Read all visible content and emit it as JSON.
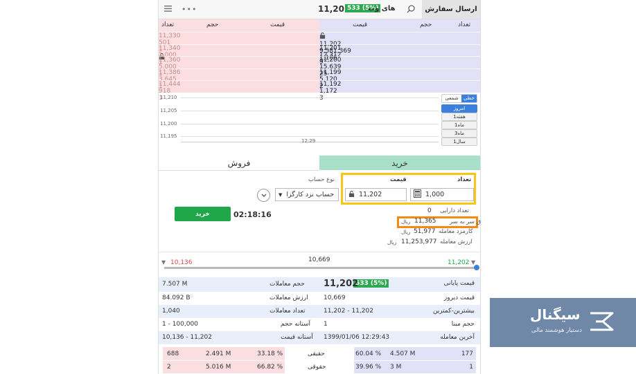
{
  "header": {
    "send_order": "ارسال سفارش",
    "stock_name": "های وب",
    "pct": "533 (5%)",
    "price": "11,202",
    "dots": "•••"
  },
  "orderbook": {
    "buy_headers": {
      "count": "تعداد",
      "volume": "حجم",
      "price": "قیمت"
    },
    "sell_headers": {
      "price": "قیمت",
      "volume": "حجم",
      "count": "تعداد"
    },
    "buy_rows": [
      {
        "count": "1,106",
        "volume": "9,581,369",
        "price": "11,202"
      },
      {
        "count": "9",
        "volume": "12,312",
        "price": "11,201"
      },
      {
        "count": "25",
        "volume": "15,639",
        "price": "11,200"
      },
      {
        "count": "2",
        "volume": "5,120",
        "price": "11,199"
      },
      {
        "count": "3",
        "volume": "1,172",
        "price": "11,192"
      }
    ],
    "sell_rows": [
      {
        "price": "11,330",
        "volume": "501",
        "count": "1"
      },
      {
        "price": "11,340",
        "volume": "1,000",
        "count": "1"
      },
      {
        "price": "11,360",
        "volume": "5,000",
        "count": "1"
      },
      {
        "price": "11,386",
        "volume": "3,645",
        "count": "1"
      },
      {
        "price": "11,444",
        "volume": "918",
        "count": "1"
      }
    ]
  },
  "chart": {
    "y_ticks": [
      "11,210",
      "11,205",
      "11,200",
      "11,195"
    ],
    "x_tick": "12:29",
    "segments": [
      "خطی",
      "شمعی"
    ],
    "ranges": [
      "امروز",
      "1هفته",
      "1ماه",
      "3ماه",
      "1سال"
    ]
  },
  "tabs": {
    "buy": "خرید",
    "sell": "فروش"
  },
  "form": {
    "qty_label": "تعداد",
    "price_label": "قیمت",
    "account_label": "نوع حساب",
    "qty_value": "1,000",
    "price_value": "11,202",
    "account_value": "حساب نزد کارگزا",
    "asset_label": "تعداد دارایی",
    "asset_value": "0",
    "breakeven_label": "ق سر به سر",
    "breakeven_value": "11,365",
    "fee_label": "کارمزد معامله",
    "fee_value": "51,977",
    "total_label": "ارزش معامله",
    "total_value": "11,253,977",
    "rial": "ریال",
    "buy_button": "خرید",
    "timer": "02:18:16"
  },
  "range": {
    "low": "10,136",
    "mid": "10,669",
    "high": "11,202"
  },
  "stats": {
    "last_price_label": "قیمت پایانی",
    "last_price": "11,202",
    "last_pct": "533 (5%)",
    "volume_label": "حجم معاملات",
    "volume": "7.507 M",
    "yesterday_label": "قیمت دیروز",
    "yesterday": "10,669",
    "value_label": "ارزش معاملات",
    "value": "84.092 B",
    "maxmin_label": "بیشترین-کمترین",
    "maxmin": "11,202  -  11,202",
    "trades_label": "تعداد معاملات",
    "trades": "1,040",
    "base_vol_label": "حجم مبنا",
    "base_vol": "1",
    "vol_threshold_label": "آستانه حجم",
    "vol_threshold": "1  -  100,000",
    "last_trade_label": "آخرین معامله",
    "last_trade": "1399/01/06 12:29:43",
    "price_threshold_label": "آستانه قیمت",
    "price_threshold": "10,136  -  11,202"
  },
  "legal": {
    "real_label": "حقیقی",
    "legal_label": "حقوقی",
    "buy_real_count": "177",
    "buy_real_vol": "4.507 M",
    "buy_real_pct": "60.04 %",
    "buy_legal_count": "1",
    "buy_legal_vol": "3 M",
    "buy_legal_pct": "39.96 %",
    "sell_real_pct": "33.18 %",
    "sell_real_vol": "2.491 M",
    "sell_real_count": "688",
    "sell_legal_pct": "66.82 %",
    "sell_legal_vol": "5.016 M",
    "sell_legal_count": "2"
  },
  "logo": {
    "name": "سیگنال",
    "tagline": "دستیار هوشمند مالی"
  },
  "colors": {
    "green": "#1fa74a",
    "buy_bg": "#e2e1f8",
    "sell_bg": "#fbdfe0",
    "highlight_yellow": "#f7c612",
    "highlight_orange": "#f28a14",
    "logo_bg": "#6f88a7"
  }
}
